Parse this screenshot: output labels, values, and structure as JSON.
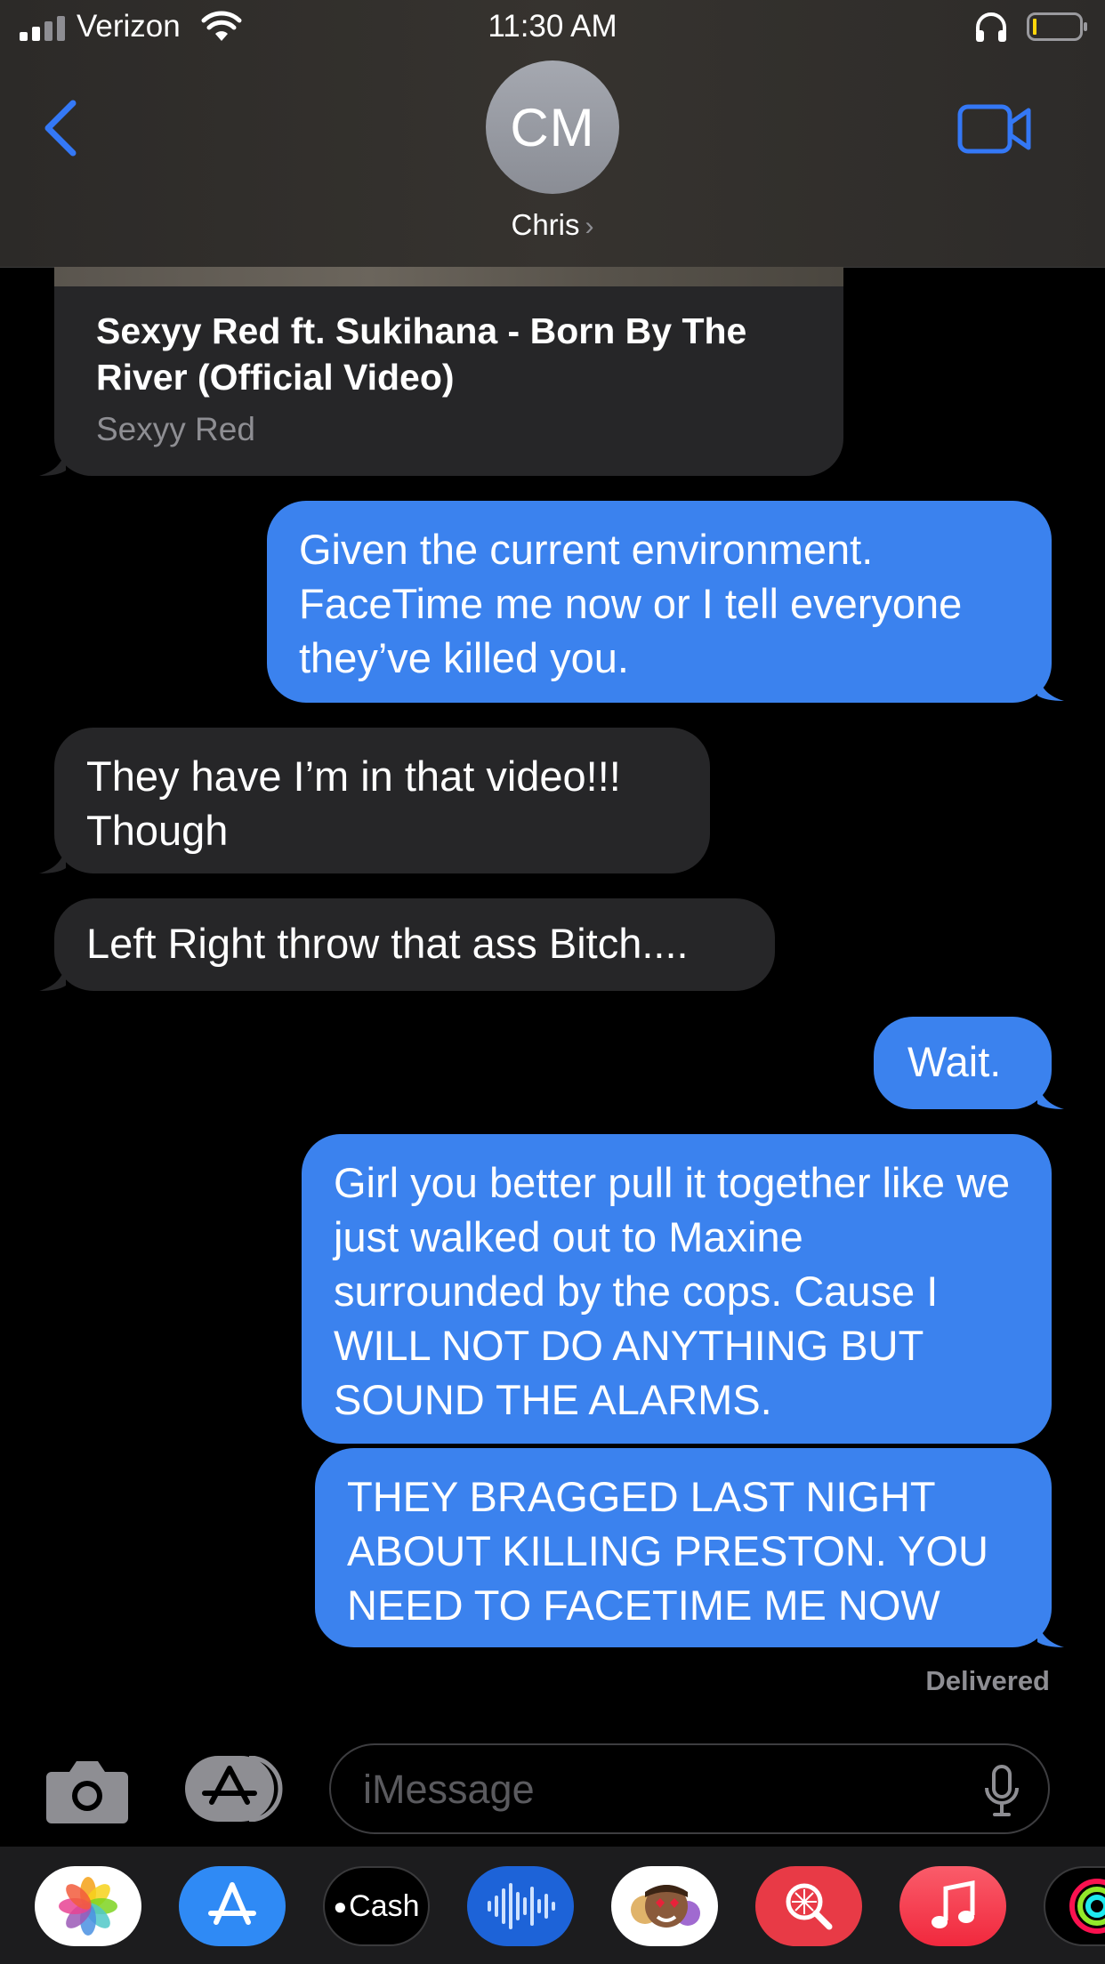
{
  "status_bar": {
    "carrier": "Verizon",
    "time": "11:30 AM",
    "icons": [
      "signal-bars-icon",
      "wifi-icon",
      "headphones-icon",
      "battery-icon"
    ]
  },
  "header": {
    "avatar_initials": "CM",
    "contact_name": "Chris",
    "chevron": "›",
    "icons": [
      "back-chevron-icon",
      "facetime-video-icon"
    ]
  },
  "link_preview": {
    "title": "Sexyy Red ft. Sukihana - Born By The River (Official Video)",
    "source": "Sexyy Red"
  },
  "messages": [
    {
      "direction": "outgoing",
      "text": "Given the current environment. FaceTime me now or I tell everyone they’ve killed you."
    },
    {
      "direction": "incoming",
      "text": "They have I’m in that video!!! Though"
    },
    {
      "direction": "incoming",
      "text": "Left Right throw that ass Bitch...."
    },
    {
      "direction": "outgoing",
      "text": "Wait."
    },
    {
      "direction": "outgoing",
      "text": "Girl you better pull it together like we just walked out to Maxine surrounded by the cops. Cause I WILL NOT DO ANYTHING BUT SOUND THE ALARMS."
    },
    {
      "direction": "outgoing",
      "text": "THEY BRAGGED LAST NIGHT ABOUT KILLING PRESTON. YOU NEED TO FACETIME ME NOW"
    }
  ],
  "delivered_label": "Delivered",
  "input_bar": {
    "placeholder": "iMessage",
    "icons": [
      "camera-icon",
      "app-store-icon",
      "microphone-icon"
    ]
  },
  "app_drawer": {
    "cash_label": "Cash",
    "apps": [
      "photos-icon",
      "app-store-icon",
      "apple-cash-icon",
      "voice-memo-icon",
      "memoji-icon",
      "image-search-icon",
      "music-icon",
      "fitness-icon"
    ]
  },
  "colors": {
    "outgoing_bubble": "#3b82ee",
    "incoming_bubble": "#262628",
    "accent_blue": "#3478f6"
  }
}
